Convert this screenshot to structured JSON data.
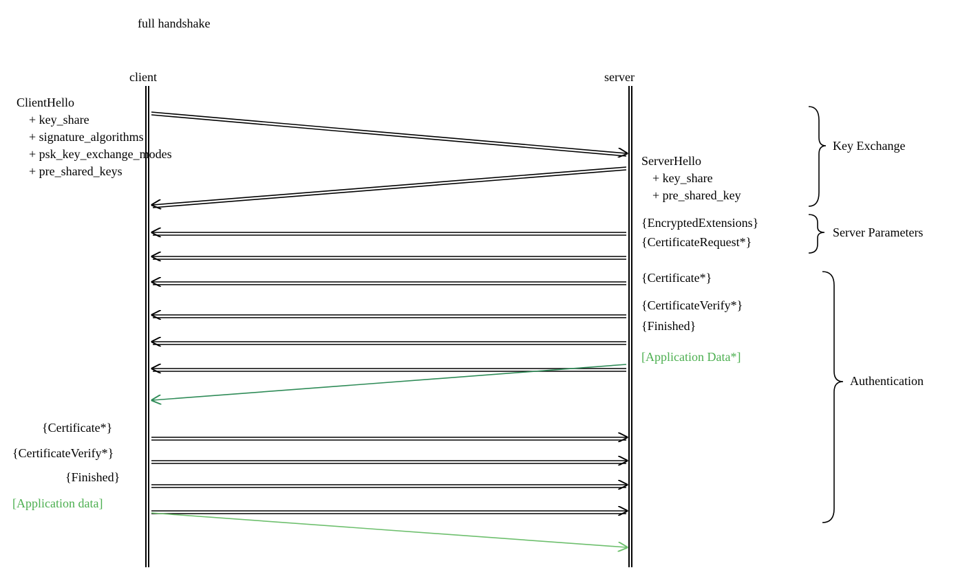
{
  "title": "full handshake",
  "actors": {
    "left": "client",
    "right": "server"
  },
  "client_hello": {
    "name": "ClientHello",
    "ext1": "+ key_share",
    "ext2": "+ signature_algorithms",
    "ext3": "+ psk_key_exchange_modes",
    "ext4": "+ pre_shared_keys"
  },
  "server_hello": {
    "name": "ServerHello",
    "ext1": "+ key_share",
    "ext2": "+ pre_shared_key"
  },
  "server_params": {
    "m1": "{EncryptedExtensions}",
    "m2": "{CertificateRequest*}"
  },
  "server_auth": {
    "m1": "{Certificate*}",
    "m2": "{CertificateVerify*}",
    "m3": "{Finished}",
    "m4": "[Application Data*]"
  },
  "client_auth": {
    "m1": "{Certificate*}",
    "m2": "{CertificateVerify*}",
    "m3": "{Finished}",
    "m4": "[Application data]"
  },
  "phases": {
    "p1": "Key Exchange",
    "p2": "Server Parameters",
    "p3": "Authentication"
  }
}
